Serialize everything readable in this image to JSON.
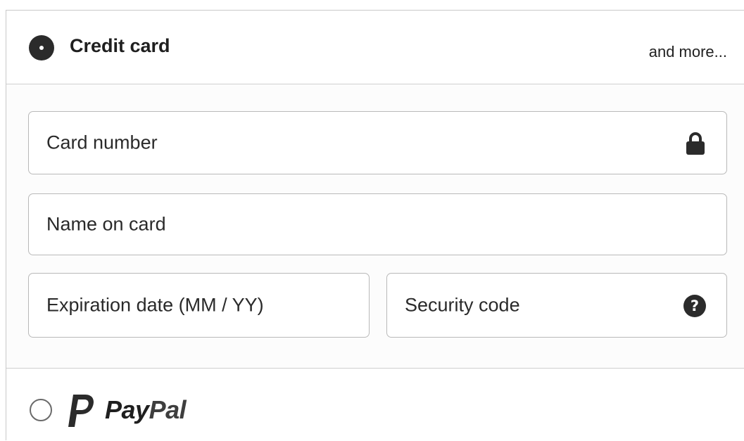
{
  "credit_card": {
    "title": "Credit card",
    "more_link": "and more...",
    "selected": true
  },
  "fields": {
    "card_number": {
      "placeholder": "Card number",
      "icon": "lock-icon"
    },
    "name_on_card": {
      "placeholder": "Name on card"
    },
    "expiration": {
      "placeholder": "Expiration date (MM / YY)"
    },
    "security_code": {
      "placeholder": "Security code",
      "help_glyph": "?"
    }
  },
  "paypal": {
    "word_pay": "Pay",
    "word_pal": "Pal",
    "selected": false,
    "icon": "paypal-logo-icon"
  },
  "colors": {
    "radio_selected": "#2b2b2b",
    "field_border": "#b9b9b9",
    "text": "#222222"
  }
}
